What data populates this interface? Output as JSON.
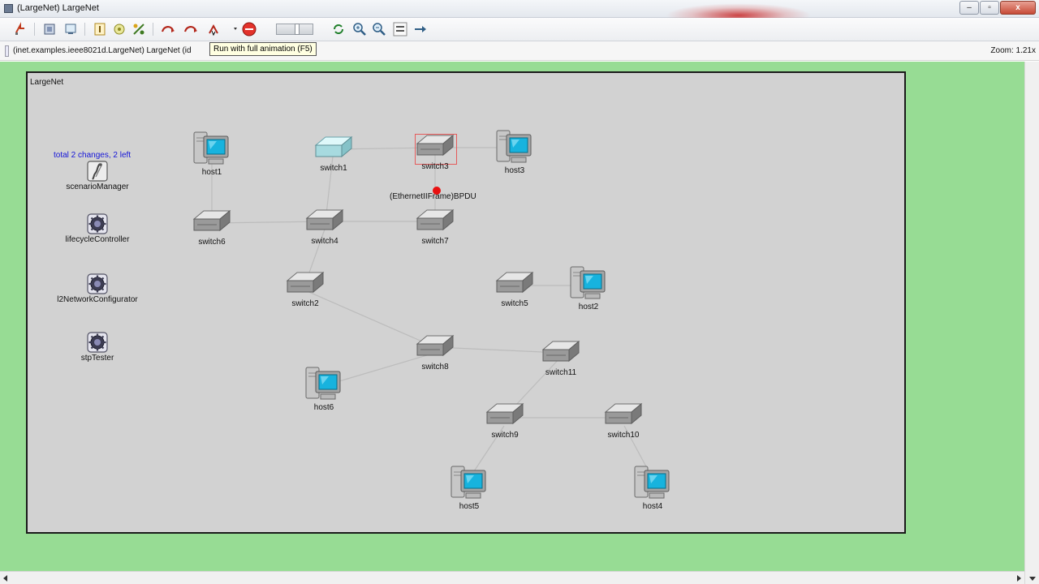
{
  "window": {
    "title": "(LargeNet) LargeNet",
    "buttons": {
      "minimize": "–",
      "maximize": "▫",
      "close": "x"
    }
  },
  "toolbar": {
    "items": [
      "load-config-icon",
      "network-overview-icon",
      "inspect-object-icon",
      "step-icon",
      "pause-icon",
      "fast-icon",
      "run-icon",
      "express-run-icon",
      "run-full-animation-icon",
      "stop-icon",
      "speed-slider",
      "rebuild-icon",
      "zoom-in-icon",
      "zoom-out-icon",
      "labels-icon",
      "arrow-icon"
    ]
  },
  "tooltip": {
    "text": "Run with full animation (F5)"
  },
  "infobar": {
    "path": "(inet.examples.ieee8021d.LargeNet) LargeNet  (id",
    "zoom": "Zoom: 1.21x"
  },
  "network": {
    "name": "LargeNet",
    "changes_text": "total 2 changes, 2 left",
    "packet_label": "(EthernetIIFrame)BPDU",
    "modules": [
      {
        "name": "scenarioManager",
        "icon": "scenario-manager-icon"
      },
      {
        "name": "lifecycleController",
        "icon": "gear-icon"
      },
      {
        "name": "l2NetworkConfigurator",
        "icon": "gear-icon"
      },
      {
        "name": "stpTester",
        "icon": "gear-icon"
      }
    ],
    "nodes": {
      "host1": "host1",
      "host2": "host2",
      "host3": "host3",
      "host4": "host4",
      "host5": "host5",
      "host6": "host6",
      "switch1": "switch1",
      "switch2": "switch2",
      "switch3": "switch3",
      "switch4": "switch4",
      "switch5": "switch5",
      "switch6": "switch6",
      "switch7": "switch7",
      "switch8": "switch8",
      "switch9": "switch9",
      "switch10": "switch10",
      "switch11": "switch11"
    }
  },
  "colors": {
    "canvas_bg": "#97dc94",
    "network_bg": "#d2d2d2",
    "changes_text": "#1414d8",
    "packet": "#e81010",
    "selection": "#e55a5a"
  }
}
